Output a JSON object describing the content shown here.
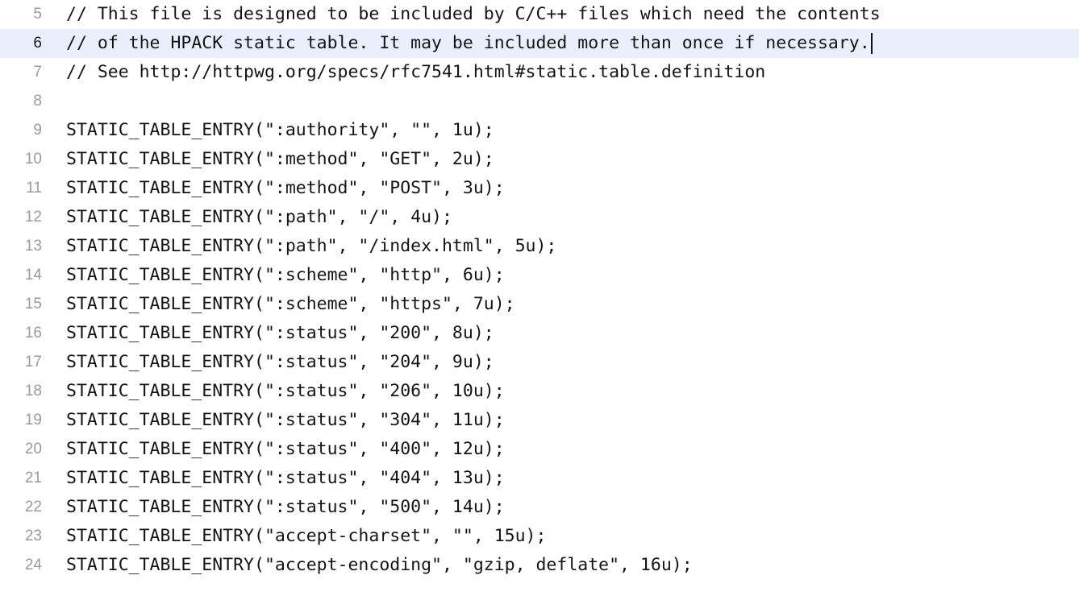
{
  "editor": {
    "lines": [
      {
        "number": "5",
        "text": "// This file is designed to be included by C/C++ files which need the contents"
      },
      {
        "number": "6",
        "text": "// of the HPACK static table. It may be included more than once if necessary."
      },
      {
        "number": "7",
        "text": "// See http://httpwg.org/specs/rfc7541.html#static.table.definition"
      },
      {
        "number": "8",
        "text": ""
      },
      {
        "number": "9",
        "text": "STATIC_TABLE_ENTRY(\":authority\", \"\", 1u);"
      },
      {
        "number": "10",
        "text": "STATIC_TABLE_ENTRY(\":method\", \"GET\", 2u);"
      },
      {
        "number": "11",
        "text": "STATIC_TABLE_ENTRY(\":method\", \"POST\", 3u);"
      },
      {
        "number": "12",
        "text": "STATIC_TABLE_ENTRY(\":path\", \"/\", 4u);"
      },
      {
        "number": "13",
        "text": "STATIC_TABLE_ENTRY(\":path\", \"/index.html\", 5u);"
      },
      {
        "number": "14",
        "text": "STATIC_TABLE_ENTRY(\":scheme\", \"http\", 6u);"
      },
      {
        "number": "15",
        "text": "STATIC_TABLE_ENTRY(\":scheme\", \"https\", 7u);"
      },
      {
        "number": "16",
        "text": "STATIC_TABLE_ENTRY(\":status\", \"200\", 8u);"
      },
      {
        "number": "17",
        "text": "STATIC_TABLE_ENTRY(\":status\", \"204\", 9u);"
      },
      {
        "number": "18",
        "text": "STATIC_TABLE_ENTRY(\":status\", \"206\", 10u);"
      },
      {
        "number": "19",
        "text": "STATIC_TABLE_ENTRY(\":status\", \"304\", 11u);"
      },
      {
        "number": "20",
        "text": "STATIC_TABLE_ENTRY(\":status\", \"400\", 12u);"
      },
      {
        "number": "21",
        "text": "STATIC_TABLE_ENTRY(\":status\", \"404\", 13u);"
      },
      {
        "number": "22",
        "text": "STATIC_TABLE_ENTRY(\":status\", \"500\", 14u);"
      },
      {
        "number": "23",
        "text": "STATIC_TABLE_ENTRY(\"accept-charset\", \"\", 15u);"
      },
      {
        "number": "24",
        "text": "STATIC_TABLE_ENTRY(\"accept-encoding\", \"gzip, deflate\", 16u);"
      }
    ],
    "current_line": "6"
  },
  "colors": {
    "background": "#ffffff",
    "current_line_highlight": "#eaf0fb",
    "line_number": "#9a9a9a",
    "text": "#141414"
  }
}
